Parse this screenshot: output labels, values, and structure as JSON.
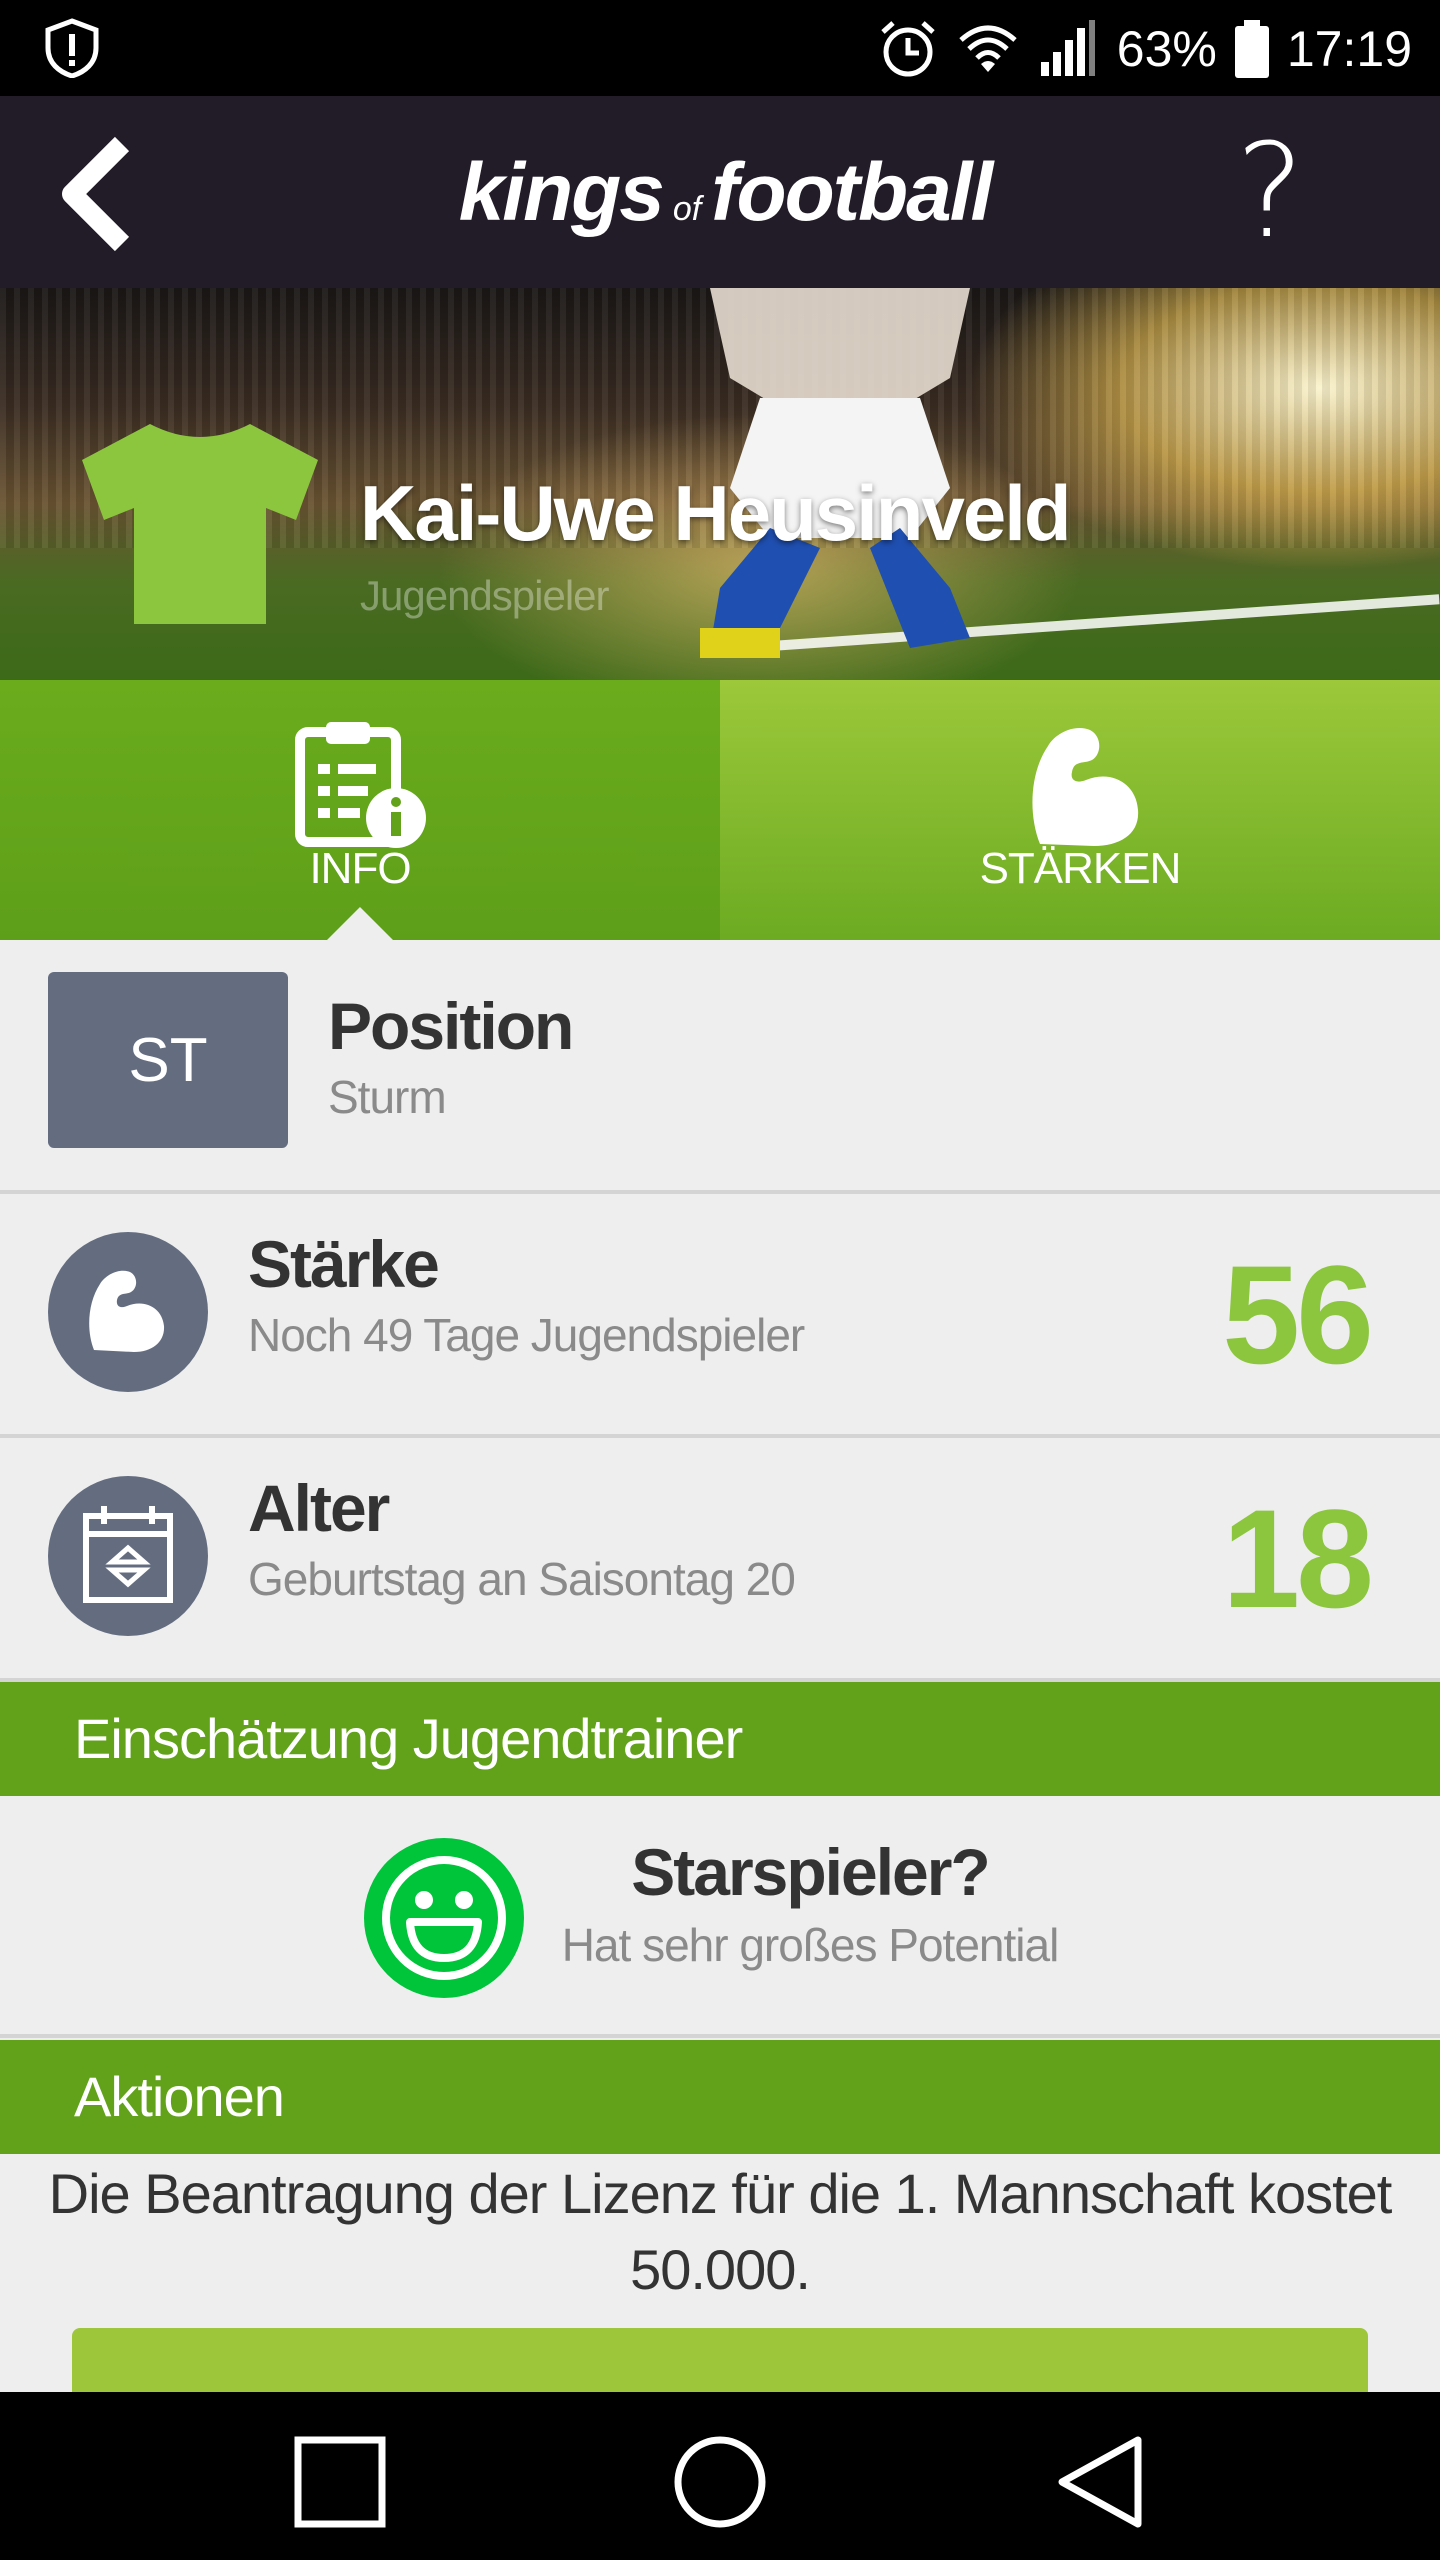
{
  "status_bar": {
    "battery": "63%",
    "time": "17:19"
  },
  "app_bar": {
    "logo_word1": "kings",
    "logo_of": "of",
    "logo_word2": "football",
    "help_label": "?"
  },
  "player": {
    "name": "Kai-Uwe Heusinveld",
    "type": "Jugendspieler",
    "jersey_color": "#8cc63f"
  },
  "tabs": [
    {
      "label": "INFO",
      "active": true
    },
    {
      "label": "STÄRKEN",
      "active": false
    }
  ],
  "info": {
    "position": {
      "badge": "ST",
      "title": "Position",
      "subtitle": "Sturm"
    },
    "strength": {
      "title": "Stärke",
      "subtitle": "Noch 49 Tage Jugendspieler",
      "value": "56"
    },
    "age": {
      "title": "Alter",
      "subtitle": "Geburtstag an Saisontag 20",
      "value": "18"
    }
  },
  "assessment": {
    "header": "Einschätzung Jugendtrainer",
    "title": "Starspieler?",
    "subtitle": "Hat sehr großes Potential",
    "smiley_color": "#00c43a"
  },
  "actions": {
    "header": "Aktionen",
    "text": "Die Beantragung der Lizenz für die 1. Mannschaft kostet 50.000."
  },
  "colors": {
    "app_bar": "#221c29",
    "accent_green": "#62a21a",
    "value_green": "#8cc63f",
    "badge_gray": "#646d80"
  }
}
